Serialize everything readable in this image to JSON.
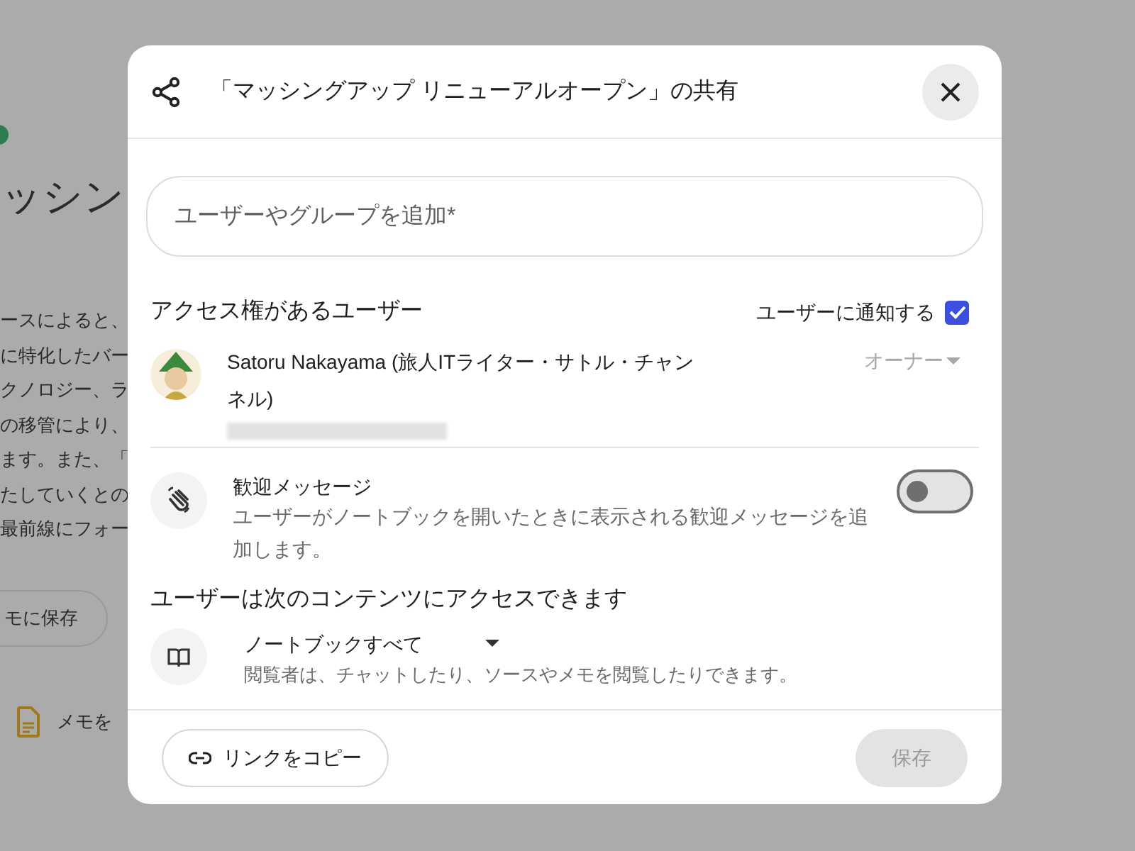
{
  "background_page": {
    "title": "ッシン",
    "paragraph_lines": [
      "ースによると、",
      "に特化したバー",
      "クノロジー、ラ",
      "の移管により、",
      "ます。また、「",
      "たしていくとの",
      "最前線にフォー"
    ],
    "save_button": "モに保存",
    "note_item": "メモを"
  },
  "dialog": {
    "title": "「マッシングアップ リニューアルオープン」の共有",
    "add_field": {
      "placeholder": "ユーザーやグループを追加*"
    },
    "access_heading": "アクセス権があるユーザー",
    "notify": {
      "label": "ユーザーに通知する",
      "checked": true
    },
    "users": [
      {
        "name": "Satoru Nakayama (旅人ITライター・サトル・チャンネル)",
        "role": "オーナー",
        "disabled": true
      }
    ],
    "welcome": {
      "title": "歓迎メッセージ",
      "description": "ユーザーがノートブックを開いたときに表示される歓迎メッセージを追加します。",
      "on": false
    },
    "content_heading": "ユーザーは次のコンテンツにアクセスできます",
    "content": {
      "scope": "ノートブックすべて",
      "description": "閲覧者は、チャットしたり、ソースやメモを閲覧したりできます。"
    },
    "copy_link_button": "リンクをコピー",
    "save_button": {
      "label": "保存",
      "disabled": true
    }
  }
}
